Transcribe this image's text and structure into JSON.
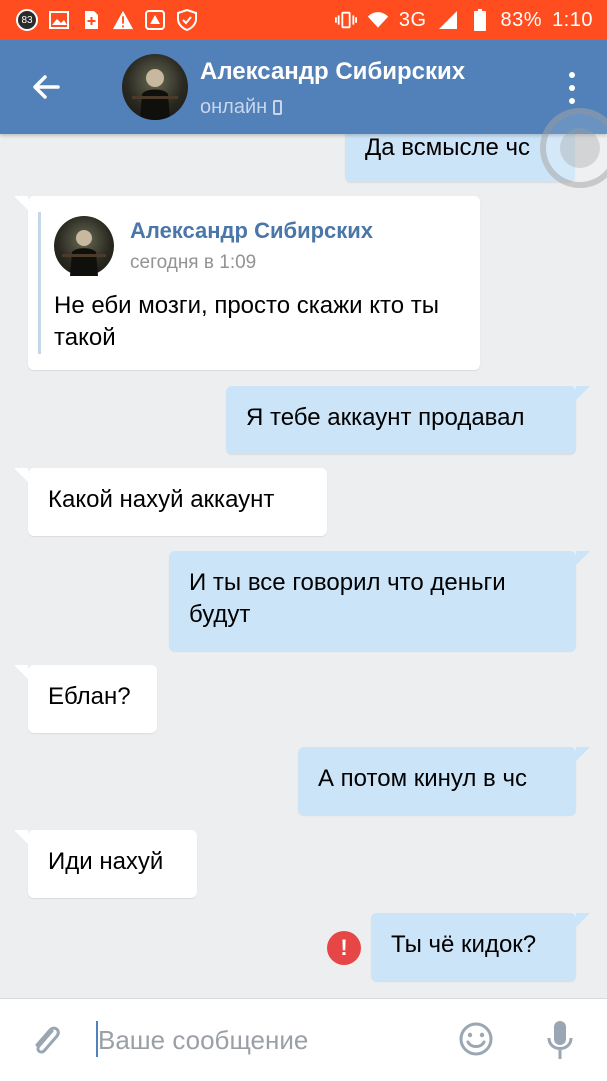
{
  "status_bar": {
    "notification_count": "83",
    "network": "3G",
    "battery": "83%",
    "time": "1:10"
  },
  "header": {
    "name": "Александр Сибирских",
    "status": "онлайн"
  },
  "messages": [
    {
      "direction": "out",
      "text": "Да всмысле чс"
    },
    {
      "direction": "in",
      "forwarded": {
        "name": "Александр Сибирских",
        "time": "сегодня в 1:09",
        "text": "Не еби мозги, просто скажи кто ты такой"
      }
    },
    {
      "direction": "out",
      "text": "Я тебе аккаунт продавал"
    },
    {
      "direction": "in",
      "text": "Какой нахуй аккаунт"
    },
    {
      "direction": "out",
      "text": "И ты все говорил что деньги будут"
    },
    {
      "direction": "in",
      "text": "Еблан?"
    },
    {
      "direction": "out",
      "text": "А потом кинул в чс"
    },
    {
      "direction": "in",
      "text": "Иди нахуй"
    },
    {
      "direction": "out",
      "text": "Ты чё кидок?",
      "error": true
    }
  ],
  "composer": {
    "placeholder": "Ваше сообщение"
  },
  "colors": {
    "status_bar": "#ff4d1f",
    "header": "#5181b8",
    "incoming_bubble": "#ffffff",
    "outgoing_bubble": "#cce4f7",
    "background": "#edeef0",
    "error": "#e64646"
  },
  "icons": [
    "back-arrow-icon",
    "more-vertical-icon",
    "phone-icon",
    "attach-icon",
    "smile-icon",
    "microphone-icon",
    "error-icon"
  ]
}
